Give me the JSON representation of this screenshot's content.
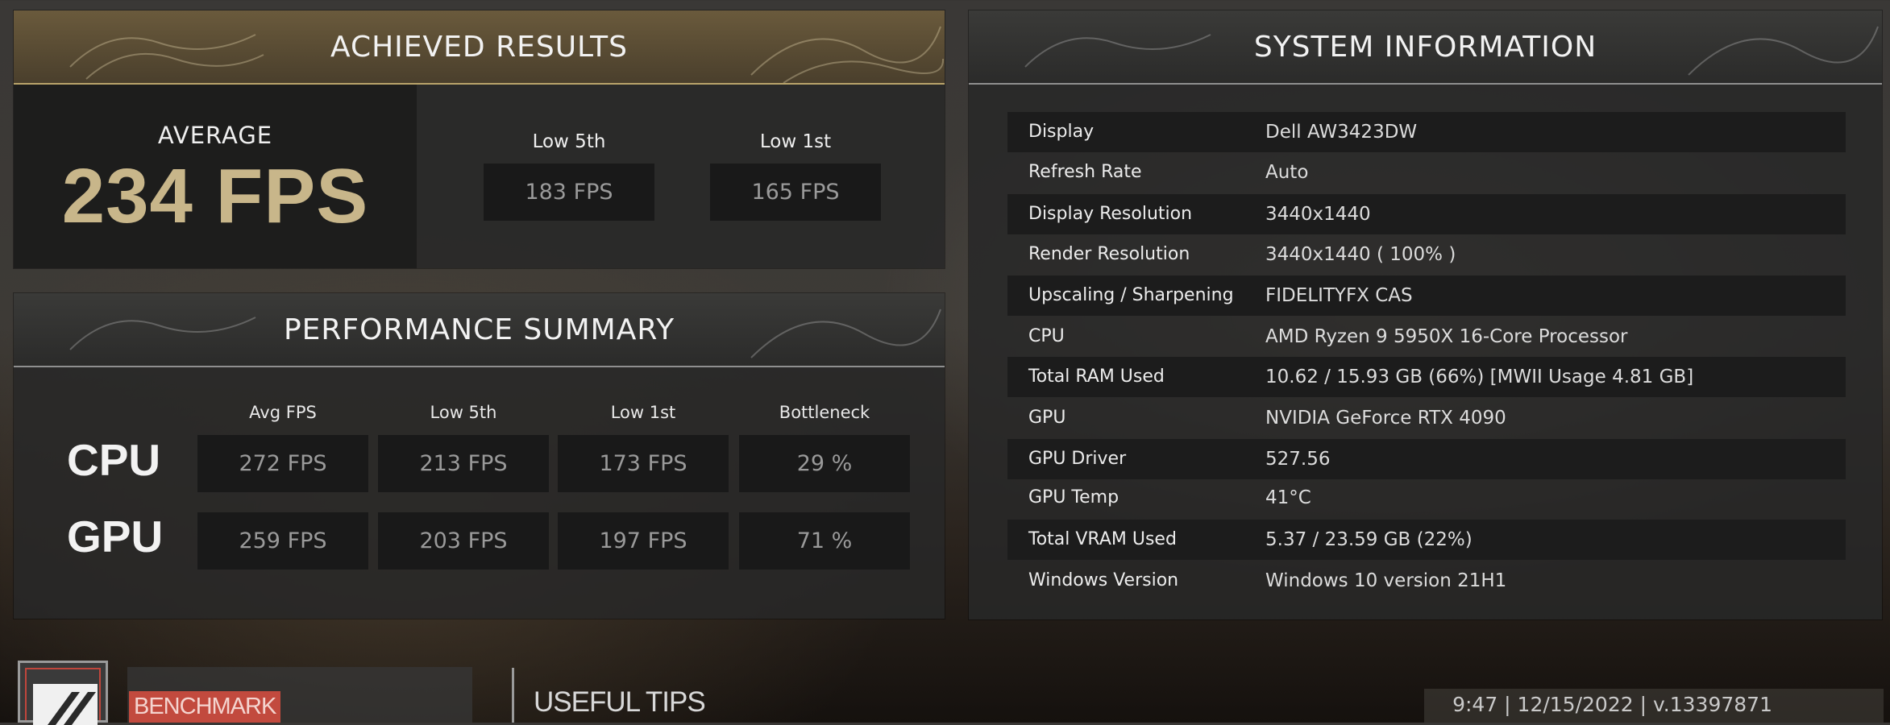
{
  "achieved": {
    "title": "ACHIEVED RESULTS",
    "average_label": "AVERAGE",
    "average_value": "234 FPS",
    "lows": [
      {
        "label": "Low 5th",
        "value": "183 FPS"
      },
      {
        "label": "Low 1st",
        "value": "165 FPS"
      }
    ]
  },
  "performance": {
    "title": "PERFORMANCE SUMMARY",
    "headers": [
      "Avg FPS",
      "Low 5th",
      "Low 1st",
      "Bottleneck"
    ],
    "rows": [
      {
        "label": "CPU",
        "values": [
          "272 FPS",
          "213 FPS",
          "173 FPS",
          "29 %"
        ]
      },
      {
        "label": "GPU",
        "values": [
          "259 FPS",
          "203 FPS",
          "197 FPS",
          "71 %"
        ]
      }
    ]
  },
  "system": {
    "title": "SYSTEM INFORMATION",
    "rows": [
      {
        "key": "Display",
        "value": "Dell AW3423DW"
      },
      {
        "key": "Refresh Rate",
        "value": "Auto"
      },
      {
        "key": "Display Resolution",
        "value": "3440x1440"
      },
      {
        "key": "Render Resolution",
        "value": "3440x1440 ( 100% )"
      },
      {
        "key": "Upscaling / Sharpening",
        "value": "FIDELITYFX CAS"
      },
      {
        "key": "CPU",
        "value": "AMD Ryzen 9 5950X 16-Core Processor"
      },
      {
        "key": "Total RAM Used",
        "value": "10.62 / 15.93 GB (66%) [MWII Usage 4.81 GB]"
      },
      {
        "key": "GPU",
        "value": "NVIDIA GeForce RTX 4090"
      },
      {
        "key": "GPU Driver",
        "value": "527.56"
      },
      {
        "key": "GPU Temp",
        "value": "41°C"
      },
      {
        "key": "Total VRAM Used",
        "value": "5.37 / 23.59 GB (22%)"
      },
      {
        "key": "Windows Version",
        "value": "Windows 10 version 21H1"
      }
    ]
  },
  "footer": {
    "benchmark_label": "BENCHMARK",
    "tips_label": "USEFUL TIPS",
    "version": "9:47 | 12/15/2022 | v.13397871"
  },
  "colors": {
    "gold_accent": "#c8b68a",
    "benchmark_red": "#c24a3e",
    "panel_bg": "#282828"
  }
}
